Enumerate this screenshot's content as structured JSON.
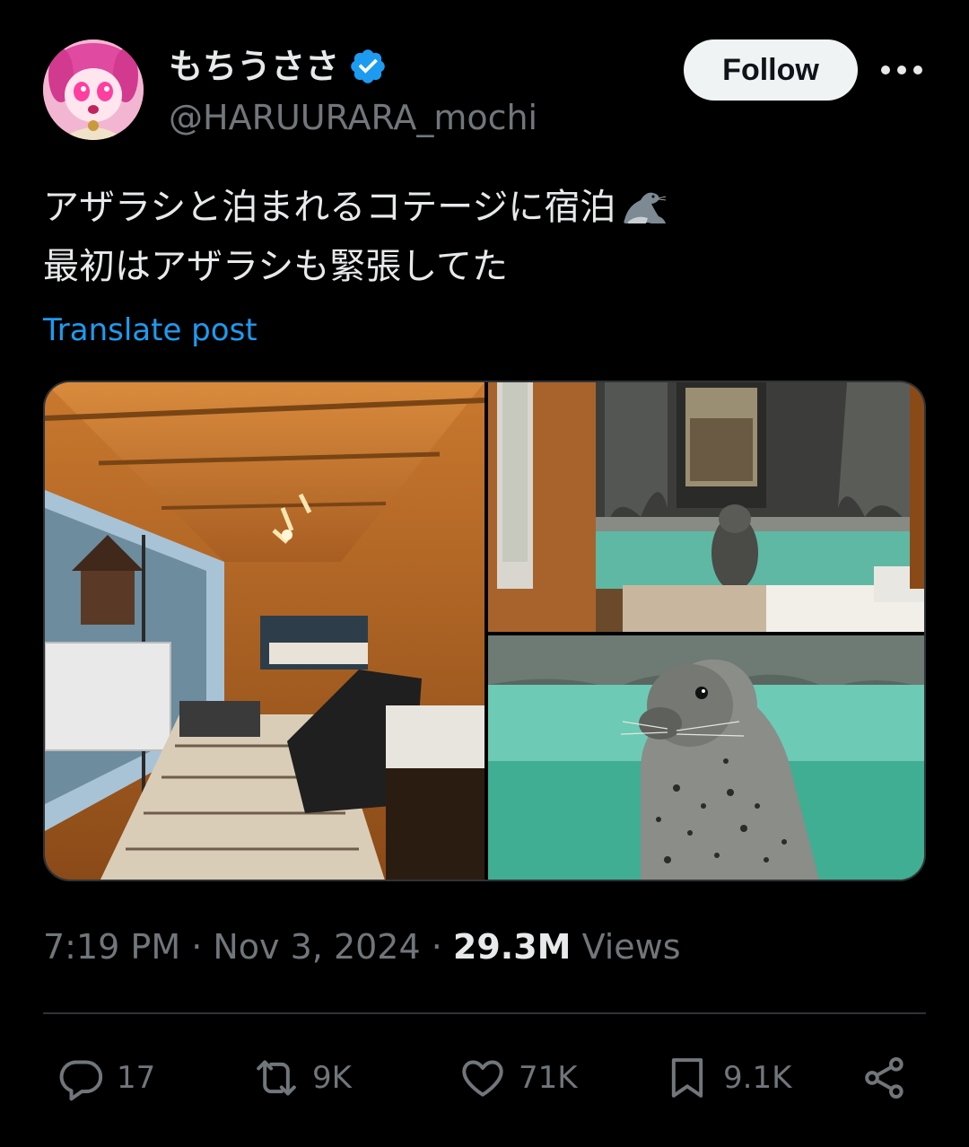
{
  "author": {
    "display_name": "もちうささ",
    "handle": "@HARUURARA_mochi",
    "verified": true,
    "verified_color": "#1d9bf0"
  },
  "follow_label": "Follow",
  "post": {
    "line1": "アザラシと泊まれるコテージに宿泊",
    "line1_emoji": "seal-emoji",
    "line2": "最初はアザラシも緊張してた"
  },
  "translate_label": "Translate post",
  "media": [
    {
      "icon": "cottage-interior-photo"
    },
    {
      "icon": "seal-in-pool-room-photo"
    },
    {
      "icon": "seal-closeup-photo"
    }
  ],
  "meta": {
    "time": "7:19 PM",
    "sep1": " · ",
    "date": "Nov 3, 2024",
    "sep2": " · ",
    "views_count": "29.3M",
    "views_label": " Views"
  },
  "actions": {
    "reply_count": "17",
    "repost_count": "9K",
    "like_count": "71K",
    "bookmark_count": "9.1K"
  },
  "colors": {
    "background": "#000000",
    "text": "#e7e9ea",
    "muted": "#71767b",
    "link": "#1d9bf0",
    "divider": "#2f3336"
  }
}
